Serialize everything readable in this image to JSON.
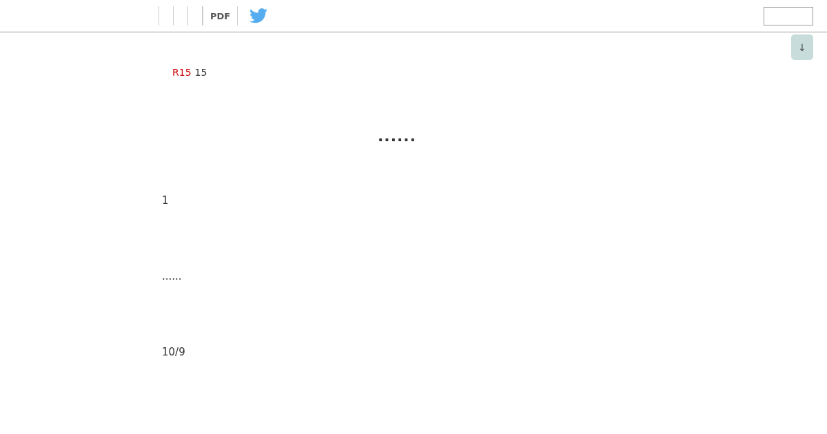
{
  "toolbar": {
    "pdf_label": "PDF"
  },
  "rating": {
    "code": "R15",
    "value": "15"
  },
  "title": "......",
  "paragraphs": [
    "1",
    "......",
    "10/9"
  ],
  "scroll_button": "↓"
}
